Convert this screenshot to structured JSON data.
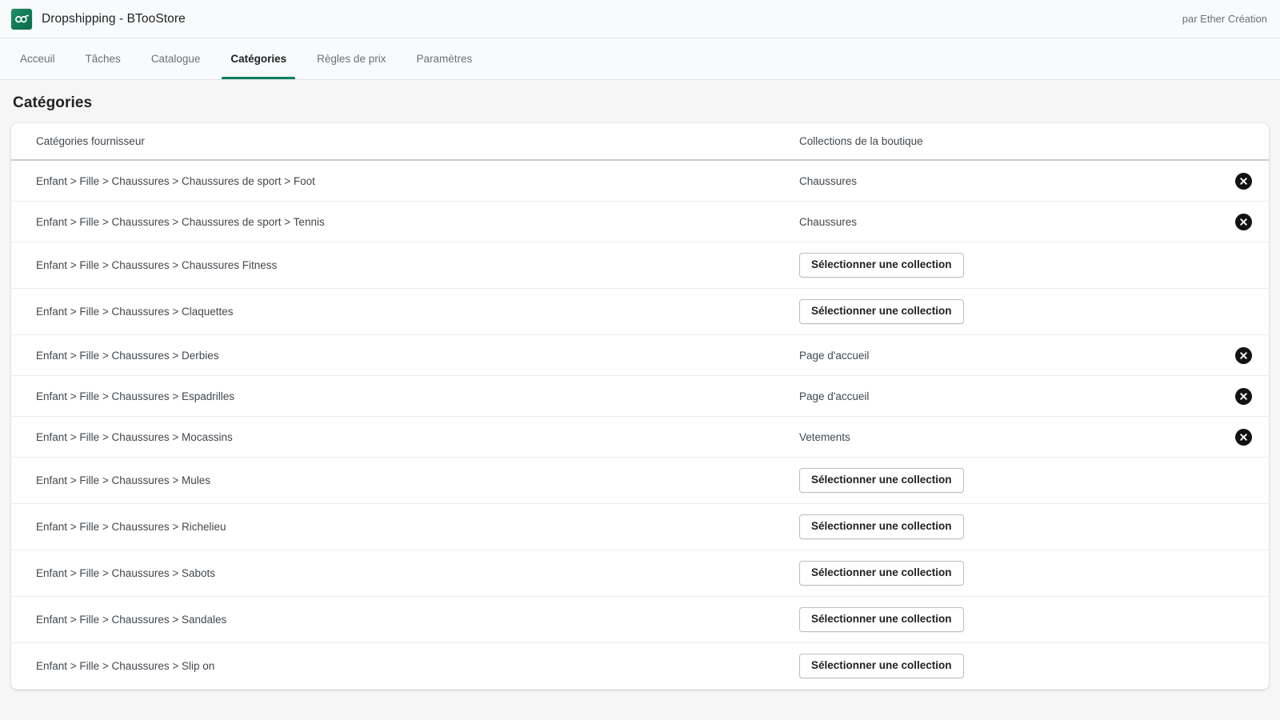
{
  "appbar": {
    "logo_icon": "infinity-logo-icon",
    "title": "Dropshipping - BTooStore",
    "credit": "par Ether Création"
  },
  "nav": {
    "tabs": [
      {
        "label": "Acceuil",
        "active": false
      },
      {
        "label": "Tâches",
        "active": false
      },
      {
        "label": "Catalogue",
        "active": false
      },
      {
        "label": "Catégories",
        "active": true
      },
      {
        "label": "Règles de prix",
        "active": false
      },
      {
        "label": "Paramètres",
        "active": false
      }
    ],
    "active_accent": "#008060"
  },
  "page": {
    "title": "Catégories"
  },
  "table": {
    "columns": {
      "category": "Catégories fournisseur",
      "collection": "Collections de la boutique"
    },
    "select_button_label": "Sélectionner une collection",
    "remove_icon": "close-circle-icon",
    "rows": [
      {
        "category": "Enfant > Fille > Chaussures > Chaussures de sport > Foot",
        "collection": "Chaussures",
        "has_collection": true
      },
      {
        "category": "Enfant > Fille > Chaussures > Chaussures de sport > Tennis",
        "collection": "Chaussures",
        "has_collection": true
      },
      {
        "category": "Enfant > Fille > Chaussures > Chaussures Fitness",
        "collection": null,
        "has_collection": false
      },
      {
        "category": "Enfant > Fille > Chaussures > Claquettes",
        "collection": null,
        "has_collection": false
      },
      {
        "category": "Enfant > Fille > Chaussures > Derbies",
        "collection": "Page d'accueil",
        "has_collection": true
      },
      {
        "category": "Enfant > Fille > Chaussures > Espadrilles",
        "collection": "Page d'accueil",
        "has_collection": true
      },
      {
        "category": "Enfant > Fille > Chaussures > Mocassins",
        "collection": "Vetements",
        "has_collection": true
      },
      {
        "category": "Enfant > Fille > Chaussures > Mules",
        "collection": null,
        "has_collection": false
      },
      {
        "category": "Enfant > Fille > Chaussures > Richelieu",
        "collection": null,
        "has_collection": false
      },
      {
        "category": "Enfant > Fille > Chaussures > Sabots",
        "collection": null,
        "has_collection": false
      },
      {
        "category": "Enfant > Fille > Chaussures > Sandales",
        "collection": null,
        "has_collection": false
      },
      {
        "category": "Enfant > Fille > Chaussures > Slip on",
        "collection": null,
        "has_collection": false
      }
    ]
  }
}
